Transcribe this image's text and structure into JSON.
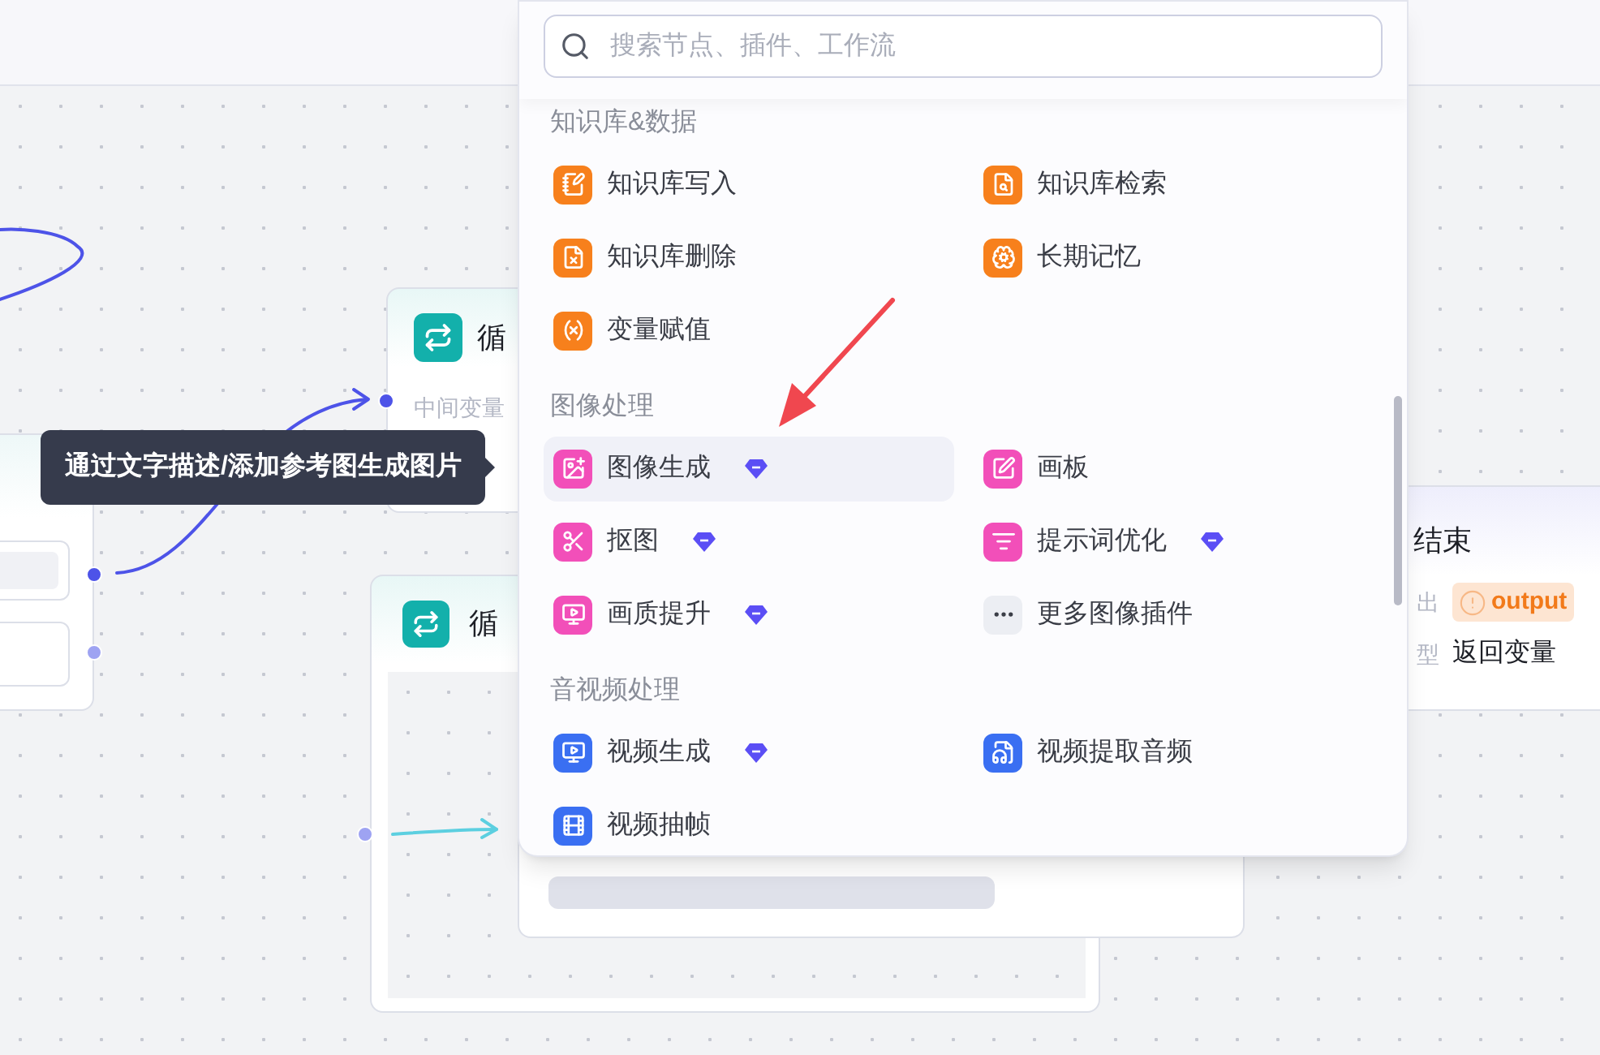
{
  "search": {
    "placeholder": "搜索节点、插件、工作流"
  },
  "sections": [
    {
      "title": "知识库&数据",
      "items": [
        {
          "label": "知识库写入",
          "color": "#f7801c",
          "premium": false,
          "selected": false
        },
        {
          "label": "知识库检索",
          "color": "#f7801c",
          "premium": false,
          "selected": false
        },
        {
          "label": "知识库删除",
          "color": "#f7801c",
          "premium": false,
          "selected": false
        },
        {
          "label": "长期记忆",
          "color": "#f7801c",
          "premium": false,
          "selected": false
        },
        {
          "label": "变量赋值",
          "color": "#f7801c",
          "premium": false,
          "selected": false
        }
      ]
    },
    {
      "title": "图像处理",
      "items": [
        {
          "label": "图像生成",
          "color": "#f24fb9",
          "premium": true,
          "selected": true
        },
        {
          "label": "画板",
          "color": "#f24fb9",
          "premium": false,
          "selected": false
        },
        {
          "label": "抠图",
          "color": "#f24fb9",
          "premium": true,
          "selected": false
        },
        {
          "label": "提示词优化",
          "color": "#f24fb9",
          "premium": true,
          "selected": false
        },
        {
          "label": "画质提升",
          "color": "#f24fb9",
          "premium": true,
          "selected": false
        },
        {
          "label": "更多图像插件",
          "color": "#eceef3",
          "premium": false,
          "selected": false
        }
      ]
    },
    {
      "title": "音视频处理",
      "items": [
        {
          "label": "视频生成",
          "color": "#3a6ff2",
          "premium": true,
          "selected": false
        },
        {
          "label": "视频提取音频",
          "color": "#3a6ff2",
          "premium": false,
          "selected": false
        },
        {
          "label": "视频抽帧",
          "color": "#3a6ff2",
          "premium": false,
          "selected": false
        }
      ]
    }
  ],
  "tooltip": {
    "text": "通过文字描述/添加参考图生成图片"
  },
  "loop_nodes": [
    {
      "title": "循",
      "variable_label": "中间变量"
    },
    {
      "title": "循"
    }
  ],
  "end_node": {
    "title": "结束",
    "output_label": "出",
    "output_badge": "output",
    "type_label": "型",
    "type_value": "返回变量"
  }
}
